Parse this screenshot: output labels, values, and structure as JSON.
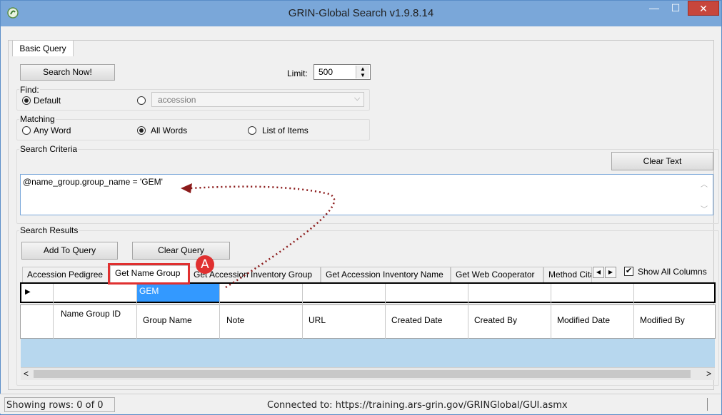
{
  "window": {
    "title": "GRIN-Global Search v1.9.8.14",
    "close_glyph": "✕",
    "minimize_glyph": "—",
    "maximize_glyph": "☐"
  },
  "tabs_top": {
    "basic_query": "Basic Query"
  },
  "toolbar": {
    "search_now": "Search Now!",
    "limit_label": "Limit:",
    "limit_value": "500"
  },
  "find": {
    "label": "Find:",
    "default_label": "Default",
    "dropdown_value": "accession"
  },
  "matching": {
    "label": "Matching",
    "options": [
      "Any Word",
      "All Words",
      "List of Items"
    ],
    "selected": "All Words"
  },
  "criteria": {
    "label": "Search Criteria",
    "clear_text": "Clear Text",
    "query_text": "@name_group.group_name = 'GEM'"
  },
  "results": {
    "label": "Search Results",
    "add_to_query": "Add To Query",
    "clear_query": "Clear Query",
    "tabs": [
      "Accession Pedigree",
      "Get Name Group",
      "Get Accession Inventory Group",
      "Get Accession Inventory Name",
      "Get Web Cooperator",
      "Method Cita"
    ],
    "active_tab": "Get Name Group",
    "show_all_columns": "Show All Columns",
    "filter_value": "GEM",
    "columns": [
      "Name Group ID",
      "Group Name",
      "Note",
      "URL",
      "Created Date",
      "Created By",
      "Modified Date",
      "Modified By"
    ]
  },
  "annotation": {
    "marker": "A",
    "highlight_color": "#e03030",
    "arrow_color": "#8b1a1a"
  },
  "status": {
    "rows": "Showing rows: 0 of 0",
    "connection": "Connected to: https://training.ars-grin.gov/GRINGlobal/GUI.asmx"
  },
  "colors": {
    "titlebar": "#7aa7d9",
    "close": "#c7463c",
    "grid_blue": "#b7d7ee",
    "selected_cell": "#3399ff"
  }
}
